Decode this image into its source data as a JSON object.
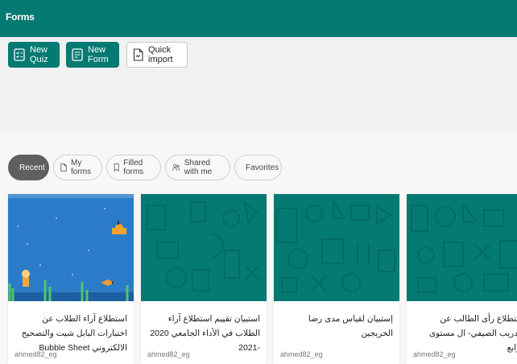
{
  "app": {
    "title": "Forms"
  },
  "toolbar": {
    "new_quiz": "New Quiz",
    "new_form": "New Form",
    "quick_import": "Quick import"
  },
  "tabs": [
    {
      "label": "Recent",
      "icon": "clock-icon",
      "active": true
    },
    {
      "label": "My forms",
      "icon": "document-icon",
      "active": false
    },
    {
      "label": "Filled forms",
      "icon": "bookmark-icon",
      "active": false
    },
    {
      "label": "Shared with me",
      "icon": "people-icon",
      "active": false
    },
    {
      "label": "Favorites",
      "icon": "star-icon",
      "active": false
    }
  ],
  "cards": [
    {
      "title": "استطلاع آراء الطلاب عن اختبارات البابل شيت والتصحيح الالكتروني Bubble Sheet",
      "owner": "ahmed82_eg",
      "thumbnail": "underwater-scene"
    },
    {
      "title": "استبيان تقييم استطلاع آراء الطلاب في الأداء الجامعي 2020 -2021",
      "owner": "ahmed82_eg",
      "thumbnail": "teal-pattern"
    },
    {
      "title": "إستبيان لقياس مدى رضا الخريجين",
      "owner": "ahmed82_eg",
      "thumbnail": "teal-pattern"
    },
    {
      "title": "استطلاع رأى الطالب عن التدريب الصيفي- ال مستوى الرابع",
      "owner": "ahmed82_eg",
      "thumbnail": "teal-pattern"
    }
  ],
  "colors": {
    "brand": "#047a72",
    "tab_active": "#5f5f5f",
    "underwater": "#2b7bc9"
  }
}
